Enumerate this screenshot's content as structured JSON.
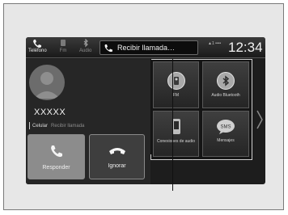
{
  "statusbar": {
    "phone_label": "Teléfono",
    "item2_label": "Fm",
    "item3_label": "Audio",
    "active_call_text": "Recibir llamada…",
    "signal_text": "▲1 ••••",
    "clock": "12:34"
  },
  "caller": {
    "name": "XXXXX",
    "number_type": "Celular",
    "dim_text": "Recibir llamada"
  },
  "buttons": {
    "answer_label": "Responder",
    "ignore_label": "Ignorar"
  },
  "apps": [
    {
      "label": "FM",
      "icon": "fm-radio-icon"
    },
    {
      "label": "Audio Bluetooth",
      "icon": "bluetooth-icon"
    },
    {
      "label": "Conexiones de audio",
      "icon": "smartphone-icon"
    },
    {
      "label": "Mensajes",
      "icon": "sms-bubble-icon"
    }
  ],
  "colors": {
    "screen_bg": "#1d1d1d",
    "answer_btn": "#8c8c8c",
    "ignore_btn": "#3e3e3e",
    "frame_bg": "#e7e7e7"
  }
}
